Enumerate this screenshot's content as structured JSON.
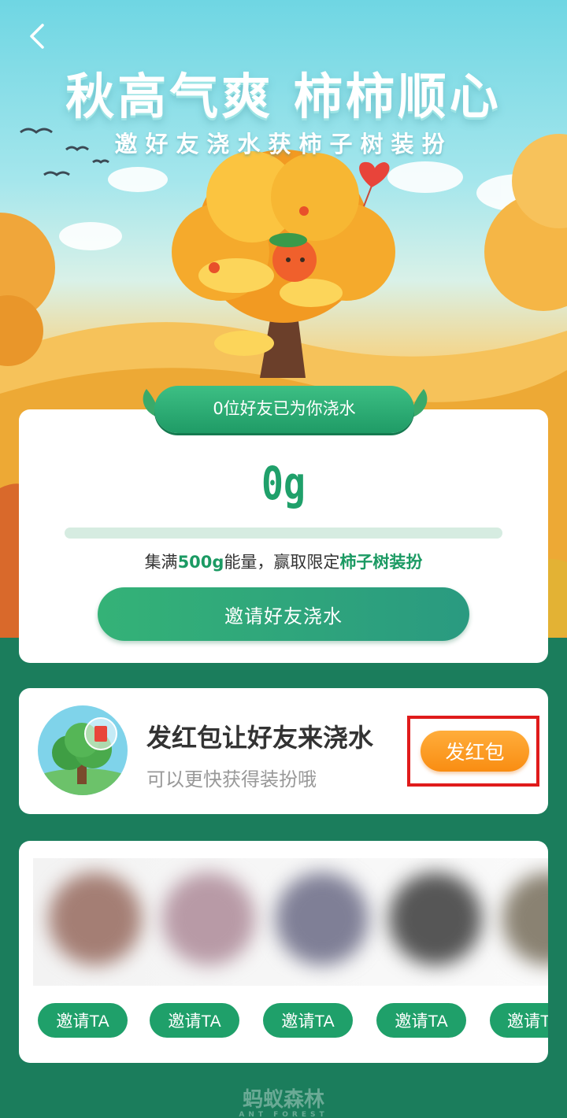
{
  "header": {
    "title": "秋高气爽 柿柿顺心",
    "subtitle": "邀好友浇水获柿子树装扮"
  },
  "energy": {
    "friends_watered": "0位好友已为你浇水",
    "value": "0g",
    "progress_fraction": 0,
    "goal_prefix": "集满",
    "goal_amount": "500g",
    "goal_mid": "能量，赢取限定",
    "goal_reward": "柿子树装扮",
    "invite_label": "邀请好友浇水"
  },
  "red_packet": {
    "title": "发红包让好友来浇水",
    "subtitle": "可以更快获得装扮哦",
    "button_label": "发红包"
  },
  "friends": {
    "invite_labels": [
      "邀请TA",
      "邀请TA",
      "邀请TA",
      "邀请TA",
      "邀请TA"
    ]
  },
  "footer": {
    "brand": "蚂蚁森林",
    "brand_en": "ANT FOREST"
  },
  "colors": {
    "primary_green": "#1fa06a",
    "orange": "#f98d12",
    "highlight_red": "#e01b1b",
    "background": "#1b7d5c"
  }
}
